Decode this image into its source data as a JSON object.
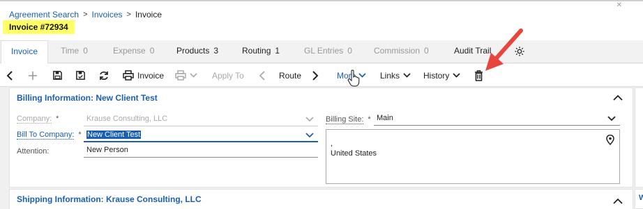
{
  "breadcrumb": {
    "items": [
      "Agreement Search",
      "Invoices",
      "Invoice"
    ]
  },
  "page_title": "Invoice #72934",
  "tabs": [
    {
      "label": "Invoice",
      "count": ""
    },
    {
      "label": "Time",
      "count": "0"
    },
    {
      "label": "Expense",
      "count": "0"
    },
    {
      "label": "Products",
      "count": "3"
    },
    {
      "label": "Routing",
      "count": "1"
    },
    {
      "label": "GL Entries",
      "count": "0"
    },
    {
      "label": "Commission",
      "count": "0"
    },
    {
      "label": "Audit Trail",
      "count": ""
    }
  ],
  "toolbar": {
    "print_label": "Invoice",
    "apply_to_label": "Apply To",
    "route_label": "Route",
    "more_label": "More",
    "links_label": "Links",
    "history_label": "History"
  },
  "billing": {
    "title": "Billing Information: New Client Test",
    "company_label": "Company:",
    "company_value": "Krause Consulting, LLC",
    "bill_to_label": "Bill To Company:",
    "bill_to_value": "New Client Test",
    "attention_label": "Attention:",
    "attention_value": "New  Person",
    "site_label": "Billing Site:",
    "site_value": "Main",
    "address_line1": ",",
    "address_line2": "United States",
    "required_mark": "*"
  },
  "shipping": {
    "title": "Shipping Information: Krause Consulting, LLC"
  },
  "side_panel_letter": "W",
  "colors": {
    "accent": "#1a5fb4",
    "highlight": "#ffff66",
    "arrow": "#e8453c"
  }
}
